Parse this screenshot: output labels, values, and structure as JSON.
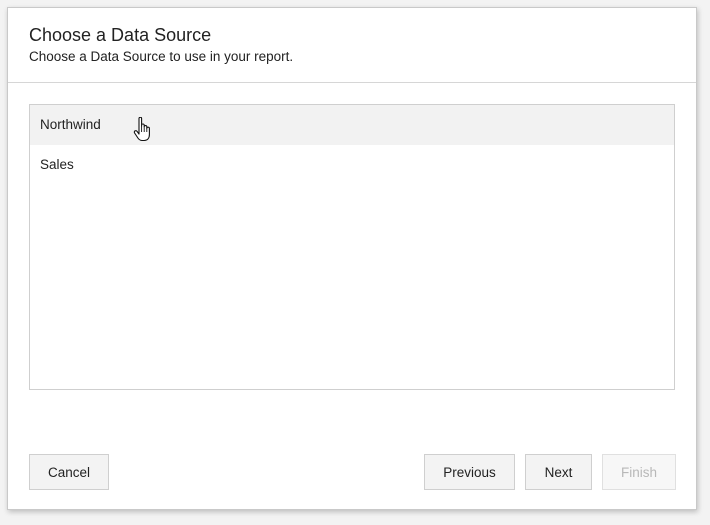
{
  "dialog": {
    "title": "Choose a Data Source",
    "subtitle": "Choose a Data Source to use in your report."
  },
  "data_sources": [
    {
      "label": "Northwind",
      "state": "hovered"
    },
    {
      "label": "Sales",
      "state": "normal"
    }
  ],
  "buttons": {
    "cancel": "Cancel",
    "previous": "Previous",
    "next": "Next",
    "finish": "Finish",
    "finish_enabled": false
  },
  "cursor": {
    "icon": "hand-pointer-icon"
  },
  "colors": {
    "hover_background": "#f2f2f2",
    "border": "#cfcfcf",
    "disabled_text": "#b8b8b8"
  }
}
